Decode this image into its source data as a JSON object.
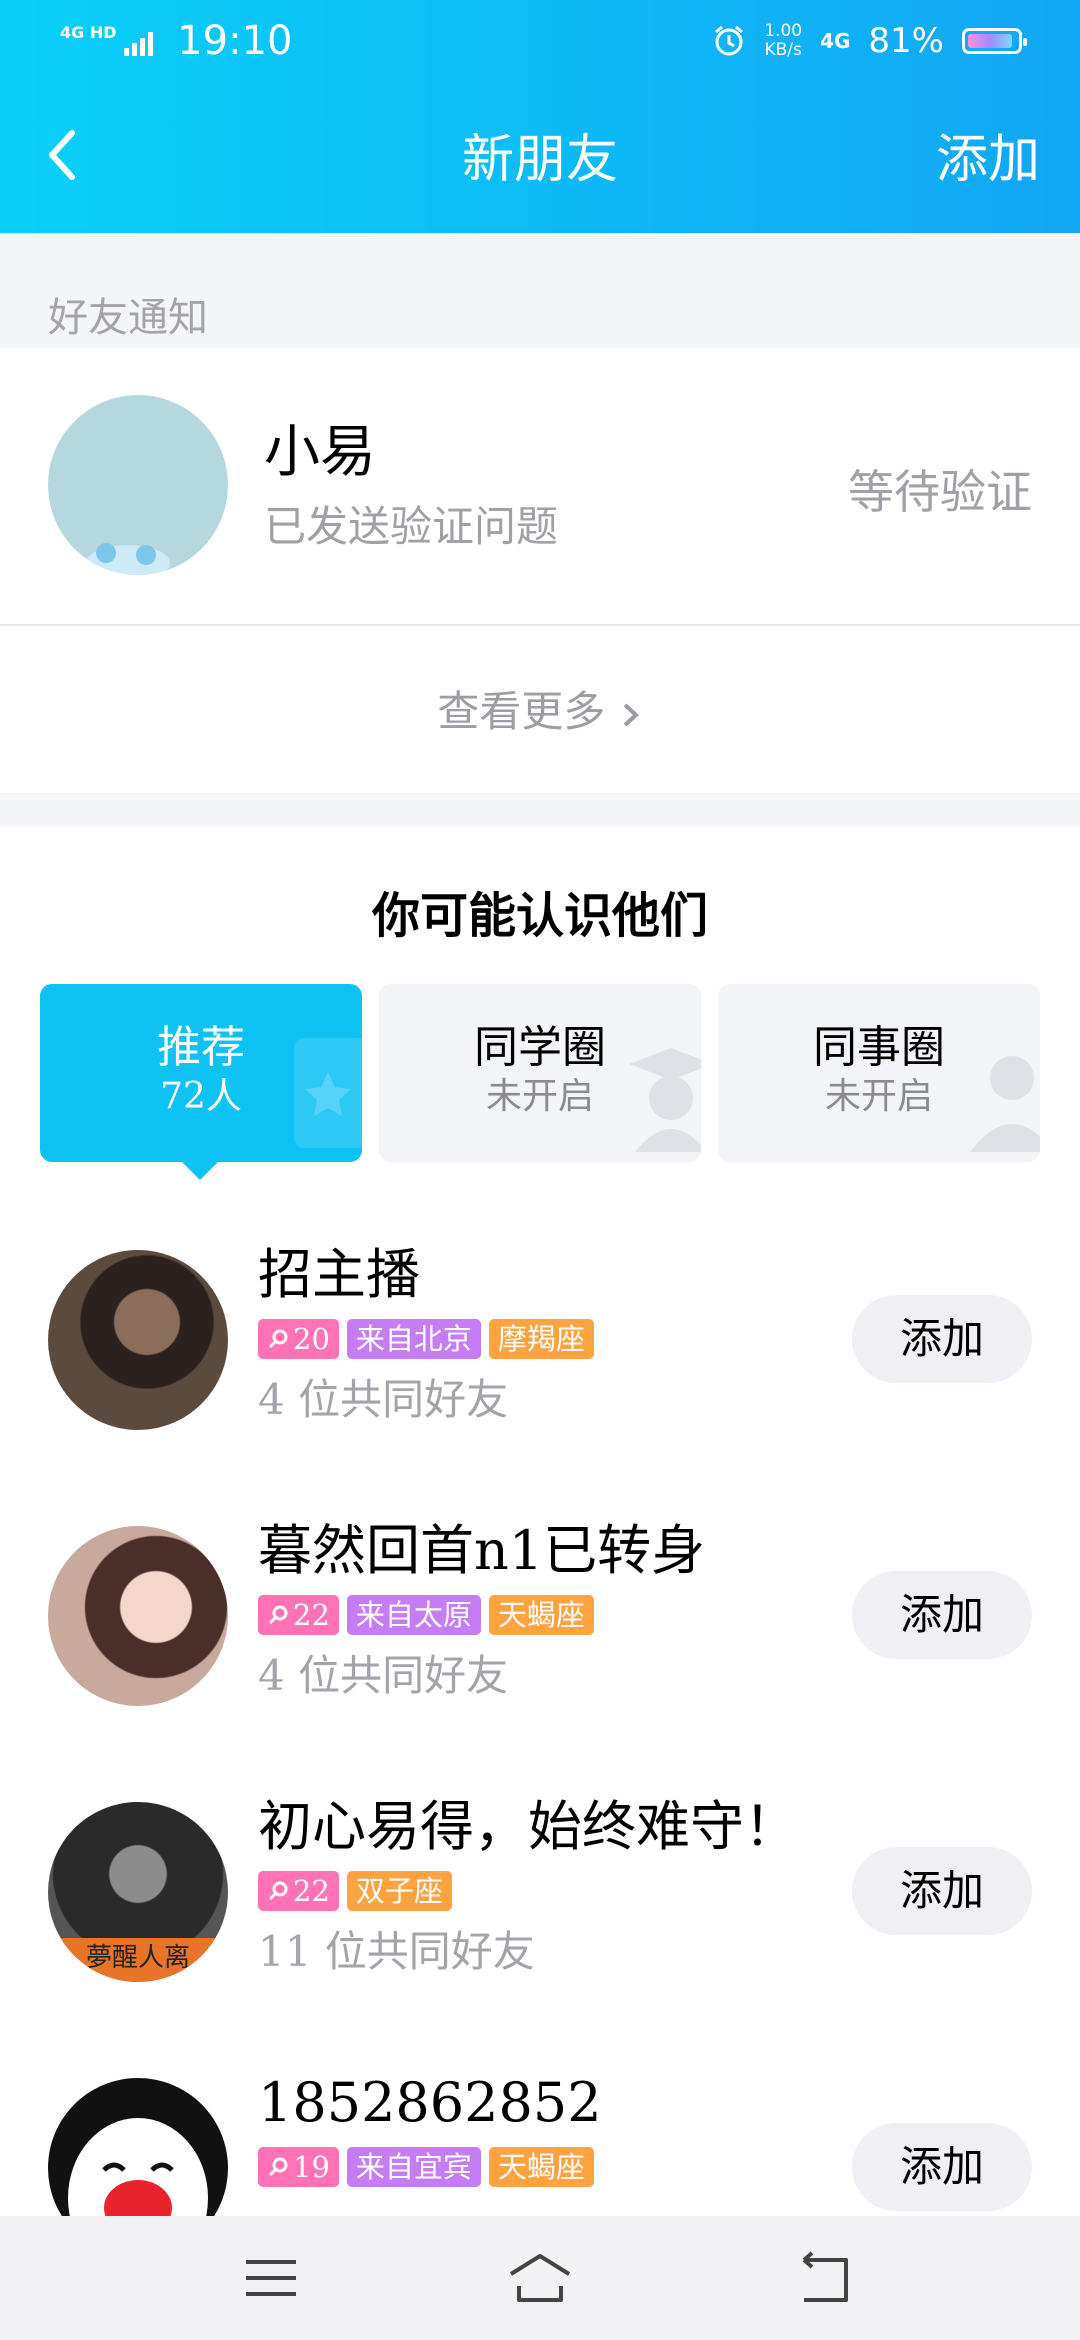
{
  "status_bar": {
    "network": "4G HD",
    "time": "19:10",
    "speed": "1.00",
    "speed_unit": "KB/s",
    "net_type": "4G",
    "battery": "81%",
    "battery_level": 0.81
  },
  "nav": {
    "title": "新朋友",
    "add_label": "添加"
  },
  "notifications": {
    "section_label": "好友通知",
    "items": [
      {
        "name": "小易",
        "subtitle": "已发送验证问题",
        "status": "等待验证"
      }
    ],
    "see_more": "查看更多"
  },
  "recommend": {
    "title": "你可能认识他们",
    "tabs": [
      {
        "label": "推荐",
        "sub": "72人",
        "active": true
      },
      {
        "label": "同学圈",
        "sub": "未开启",
        "active": false
      },
      {
        "label": "同事圈",
        "sub": "未开启",
        "active": false
      }
    ],
    "people": [
      {
        "name": "招主播",
        "age": "20",
        "location": "来自北京",
        "zodiac": "摩羯座",
        "mutual": "4 位共同好友",
        "add": "添加"
      },
      {
        "name": "暮然回首n1已转身",
        "age": "22",
        "location": "来自太原",
        "zodiac": "天蝎座",
        "mutual": "4 位共同好友",
        "add": "添加"
      },
      {
        "name": "初心易得，始终难守！",
        "age": "22",
        "zodiac": "双子座",
        "mutual": "11 位共同好友",
        "add": "添加",
        "avatar_text": "夢醒人离"
      },
      {
        "name": "1852862852",
        "age": "19",
        "location": "来自宜宾",
        "zodiac": "天蝎座",
        "add": "添加"
      }
    ]
  },
  "colors": {
    "header_start": "#0ad0f8",
    "header_end": "#12a6f4",
    "accent": "#0fc2f4",
    "tag_age": "#ff72b6",
    "tag_location": "#c57cf5",
    "tag_zodiac": "#ffa240"
  }
}
